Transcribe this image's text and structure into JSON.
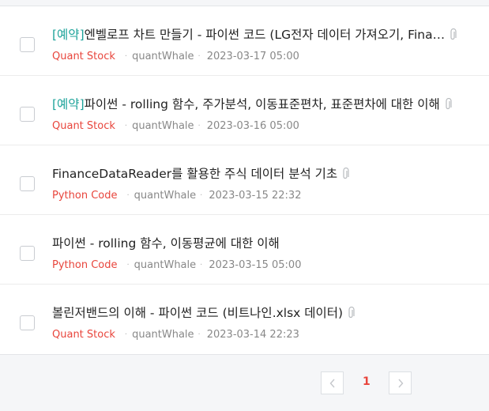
{
  "posts": [
    {
      "tag": "[예약]",
      "title": "엔벨로프 차트 만들기 - 파이썬 코드 (LG전자 데이터 가져오기, Fina…",
      "attachment": true,
      "category": "Quant Stock",
      "author": "quantWhale",
      "date": "2023-03-17 05:00"
    },
    {
      "tag": "[예약]",
      "title": "파이썬 - rolling 함수, 주가분석, 이동표준편차, 표준편차에 대한 이해",
      "attachment": true,
      "category": "Quant Stock",
      "author": "quantWhale",
      "date": "2023-03-16 05:00"
    },
    {
      "tag": "",
      "title": "FinanceDataReader를 활용한 주식 데이터 분석 기초",
      "attachment": true,
      "category": "Python Code",
      "author": "quantWhale",
      "date": "2023-03-15 22:32"
    },
    {
      "tag": "",
      "title": "파이썬 - rolling 함수, 이동평균에 대한 이해",
      "attachment": false,
      "category": "Python Code",
      "author": "quantWhale",
      "date": "2023-03-15 05:00"
    },
    {
      "tag": "",
      "title": "볼린저밴드의 이해 - 파이썬 코드 (비트나인.xlsx 데이터)",
      "attachment": true,
      "category": "Quant Stock",
      "author": "quantWhale",
      "date": "2023-03-14 22:23"
    }
  ],
  "pagination": {
    "current_page": "1",
    "prev_icon": "chevron-left-icon",
    "next_icon": "chevron-right-icon"
  },
  "colors": {
    "tag": "#1da39a",
    "category": "#e8453c",
    "current_page": "#e8453c"
  }
}
